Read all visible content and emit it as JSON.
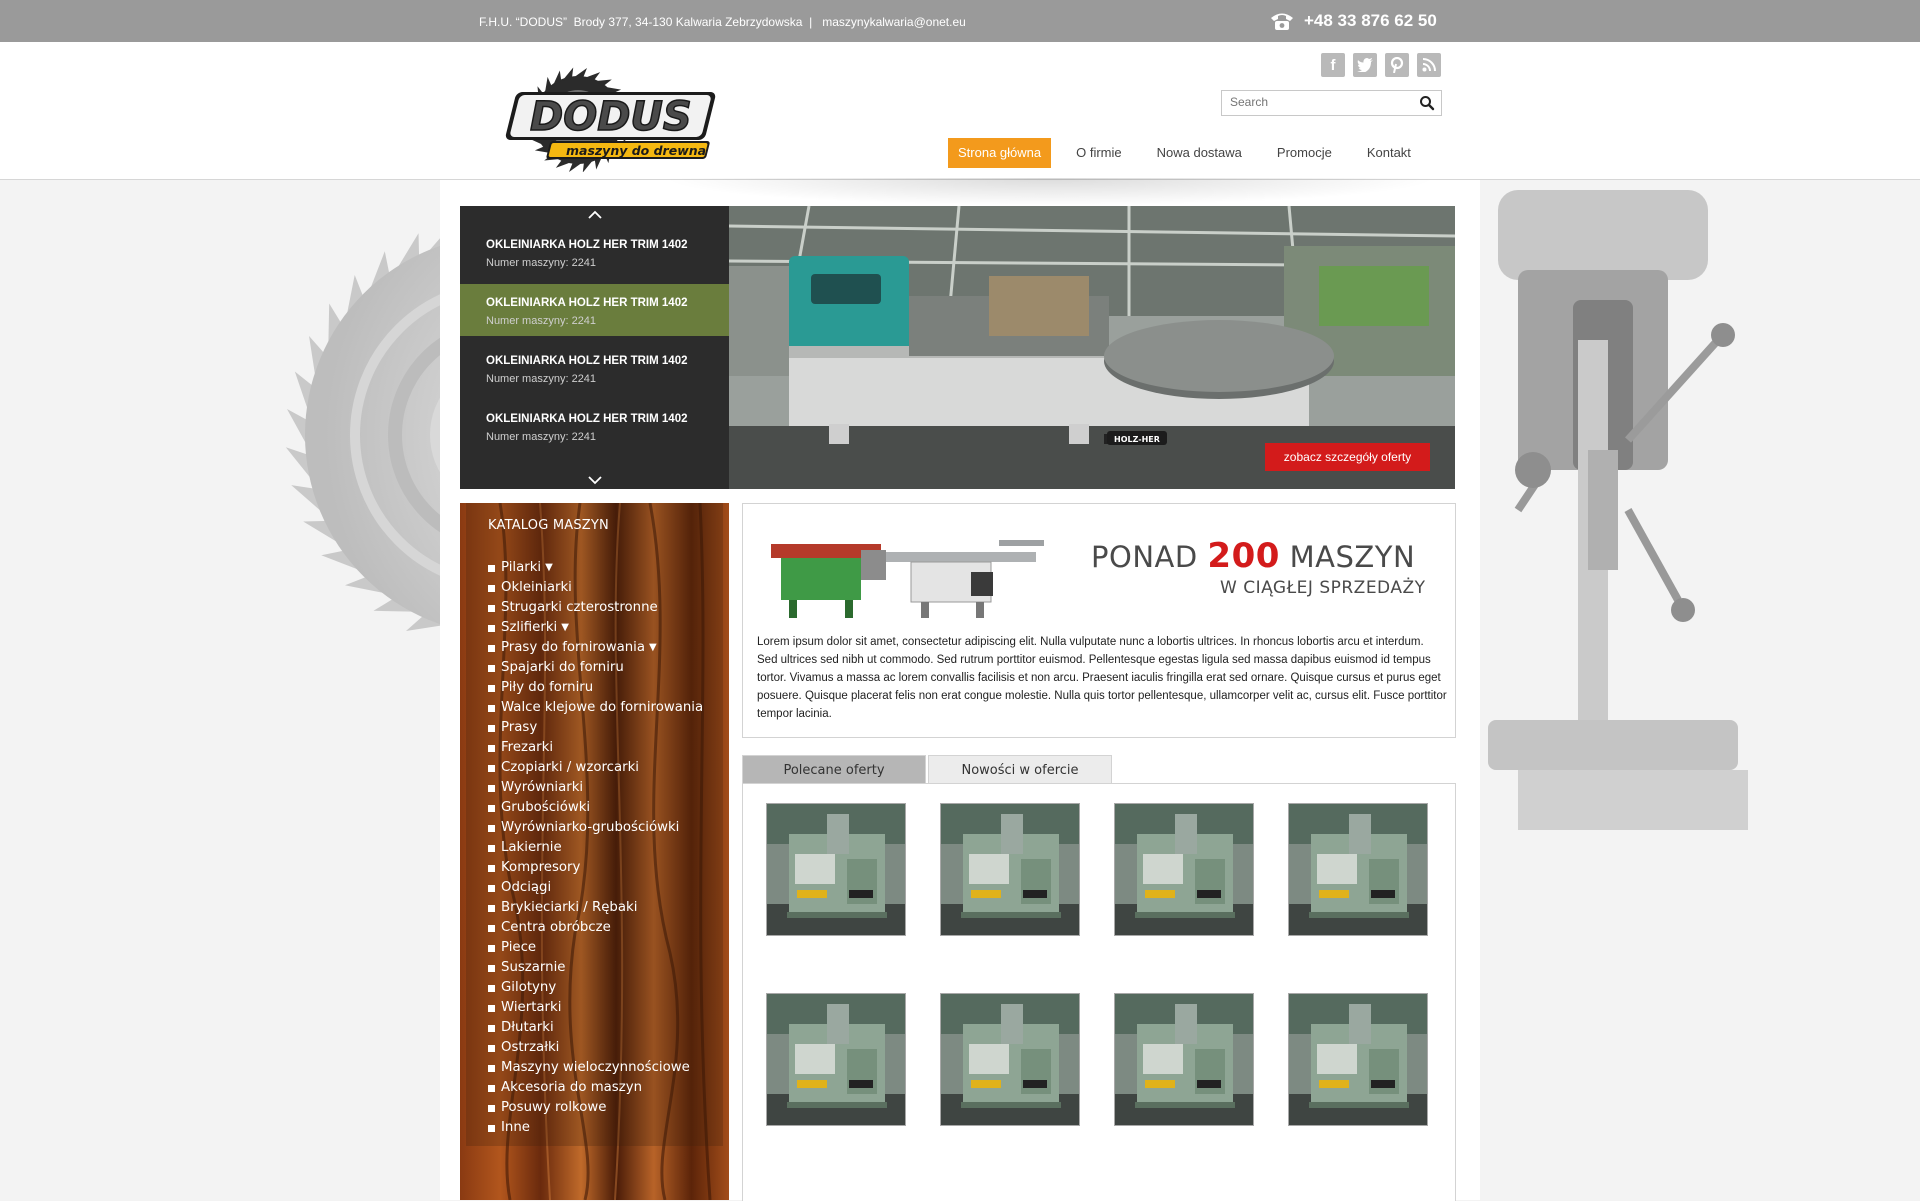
{
  "topbar": {
    "contact": "F.H.U. “DODUS”  Brody 377, 34-130 Kalwaria Zebrzydowska  |   maszynykalwaria@onet.eu",
    "phone": "+48 33 876 62 50"
  },
  "logo": {
    "name": "DODUS",
    "tagline": "maszyny do drewna"
  },
  "social": [
    "facebook-icon",
    "twitter-icon",
    "pinterest-icon",
    "rss-icon"
  ],
  "search": {
    "placeholder": "Search"
  },
  "nav": [
    {
      "label": "Strona główna",
      "active": true
    },
    {
      "label": "O firmie"
    },
    {
      "label": "Nowa dostawa"
    },
    {
      "label": "Promocje"
    },
    {
      "label": "Kontakt"
    }
  ],
  "slider": {
    "items": [
      {
        "title": "OKLEINIARKA HOLZ HER TRIM 1402",
        "number": "Numer maszyny: 2241"
      },
      {
        "title": "OKLEINIARKA HOLZ HER TRIM 1402",
        "number": "Numer maszyny: 2241",
        "active": true
      },
      {
        "title": "OKLEINIARKA HOLZ HER TRIM 1402",
        "number": "Numer maszyny: 2241"
      },
      {
        "title": "OKLEINIARKA HOLZ HER TRIM 1402",
        "number": "Numer maszyny: 2241"
      }
    ],
    "button": "zobacz szczegóły oferty",
    "machine_brand": "HOLZ-HER"
  },
  "catalog": {
    "title": "KATALOG MASZYN",
    "items": [
      {
        "label": "Pilarki",
        "sub": true
      },
      {
        "label": "Okleiniarki"
      },
      {
        "label": "Strugarki czterostronne"
      },
      {
        "label": "Szlifierki",
        "sub": true
      },
      {
        "label": "Prasy do fornirowania",
        "sub": true
      },
      {
        "label": "Spajarki do forniru"
      },
      {
        "label": "Piły do forniru"
      },
      {
        "label": "Walce klejowe do fornirowania"
      },
      {
        "label": "Prasy"
      },
      {
        "label": "Frezarki"
      },
      {
        "label": "Czopiarki / wzorcarki"
      },
      {
        "label": "Wyrówniarki"
      },
      {
        "label": "Grubościówki"
      },
      {
        "label": "Wyrówniarko-grubościówki"
      },
      {
        "label": "Lakiernie"
      },
      {
        "label": "Kompresory"
      },
      {
        "label": "Odciągi"
      },
      {
        "label": "Brykieciarki / Rębaki"
      },
      {
        "label": "Centra obróbcze"
      },
      {
        "label": "Piece"
      },
      {
        "label": "Suszarnie"
      },
      {
        "label": "Gilotyny"
      },
      {
        "label": "Wiertarki"
      },
      {
        "label": "Dłutarki"
      },
      {
        "label": "Ostrzałki"
      },
      {
        "label": "Maszyny wieloczynnościowe"
      },
      {
        "label": "Akcesoria do maszyn"
      },
      {
        "label": "Posuwy rolkowe"
      },
      {
        "label": "Inne"
      }
    ]
  },
  "promo": {
    "headline_pre": "PONAD ",
    "headline_num": "200",
    "headline_post": " MASZYN",
    "headline_line2": "W CIĄGŁEJ SPRZEDAŻY",
    "text": "Lorem ipsum dolor sit amet, consectetur adipiscing elit. Nulla vulputate nunc a lobortis ultrices. In rhoncus lobortis arcu et interdum. Sed ultrices sed nibh ut commodo. Sed rutrum porttitor euismod. Pellentesque egestas ligula sed massa dapibus euismod id tempus tortor. Vivamus a massa ac lorem convallis facilisis et non arcu. Praesent iaculis fringilla erat sed ornare. Quisque cursus et purus eget posuere. Quisque placerat felis non erat congue molestie. Nulla quis tortor pellentesque, ullamcorper velit ac, cursus elit. Fusce porttitor tempor lacinia."
  },
  "tabs": [
    {
      "label": "Polecane oferty",
      "active": true
    },
    {
      "label": "Nowości w ofercie"
    }
  ],
  "products": 8,
  "colors": {
    "accent": "#f39a1c",
    "red": "#d31b1b",
    "slider_active": "#6a7d3d"
  }
}
